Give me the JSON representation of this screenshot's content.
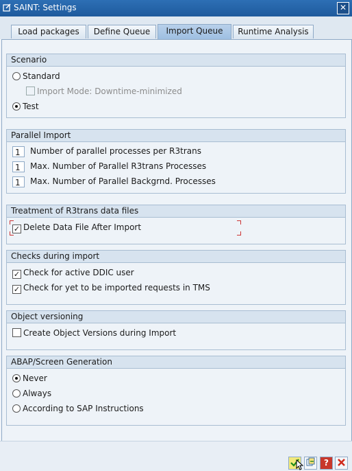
{
  "window": {
    "title": "SAINT: Settings",
    "close_glyph": "✕"
  },
  "tabs": [
    {
      "label": "Load packages"
    },
    {
      "label": "Define Queue"
    },
    {
      "label": "Import Queue"
    },
    {
      "label": "Runtime Analysis"
    }
  ],
  "scenario": {
    "title": "Scenario",
    "standard": "Standard",
    "import_mode": "Import Mode: Downtime-minimized",
    "test": "Test"
  },
  "parallel": {
    "title": "Parallel Import",
    "processes_value": "1",
    "processes_label": "Number of parallel processes per R3trans",
    "r3trans_value": "1",
    "r3trans_label": "Max. Number of Parallel R3trans Processes",
    "backgrnd_value": "1",
    "backgrnd_label": "Max. Number of Parallel Backgrnd. Processes"
  },
  "r3trans": {
    "title": "Treatment of R3trans data files",
    "delete_label": "Delete Data File After Import"
  },
  "checks": {
    "title": "Checks during import",
    "ddic_label": "Check for active DDIC user",
    "tms_label": "Check for yet to be imported requests in TMS"
  },
  "versioning": {
    "title": "Object versioning",
    "create_label": "Create Object Versions during Import"
  },
  "abap": {
    "title": "ABAP/Screen Generation",
    "never": "Never",
    "always": "Always",
    "according": "According to SAP Instructions"
  },
  "footer": {
    "confirm_icon": "check-icon",
    "copy_icon": "copy-icon",
    "help_icon": "help-icon",
    "cancel_icon": "cancel-icon"
  },
  "colors": {
    "titlebar": "#1e5a9c",
    "active_tab": "#9ebfe2",
    "focus_marker": "#cc3333"
  }
}
